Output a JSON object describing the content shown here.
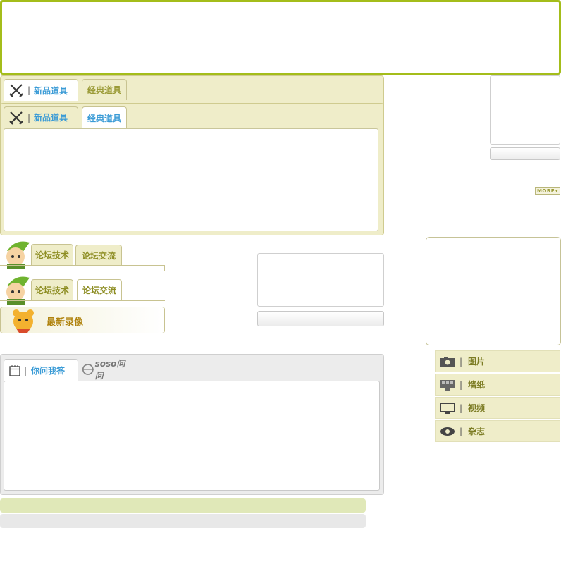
{
  "items_panel": {
    "back_tabs": [
      {
        "label": "新品道具",
        "icon": "crossed-swords-icon"
      },
      {
        "label": "经典道具"
      }
    ],
    "front_tabs": [
      {
        "label": "新品道具",
        "icon": "crossed-swords-icon"
      },
      {
        "label": "经典道具"
      }
    ],
    "separator": "|"
  },
  "more_button": {
    "label": "MORE"
  },
  "forum": {
    "back_tabs": [
      {
        "label": "论坛技术"
      },
      {
        "label": "论坛交流"
      }
    ],
    "front_tabs": [
      {
        "label": "论坛技术"
      },
      {
        "label": "论坛交流"
      }
    ],
    "mascot_icon": "cartoon-adventurer-avatar",
    "recordings_title": "最新录像",
    "recordings_icon": "cartoon-bear-icon"
  },
  "qa_panel": {
    "tabs": [
      {
        "label": "你问我答",
        "icon": "notepad-icon"
      }
    ],
    "separator": "|",
    "brand_logo": "soso问问",
    "brand_icon": "soso-logo-icon"
  },
  "media_menu": {
    "separator": "|",
    "items": [
      {
        "label": "图片",
        "icon": "camera-icon"
      },
      {
        "label": "墙纸",
        "icon": "wallpaper-icon"
      },
      {
        "label": "视频",
        "icon": "monitor-icon"
      },
      {
        "label": "杂志",
        "icon": "eye-icon"
      }
    ]
  },
  "colors": {
    "banner_border": "#a4bd1a",
    "panel_bg": "#efedc9",
    "tab_active_text": "#3a9bd6",
    "tab_inactive_text": "#9a9a36",
    "bar_green": "#e0e8b8",
    "bar_grey": "#e8e8e8"
  }
}
